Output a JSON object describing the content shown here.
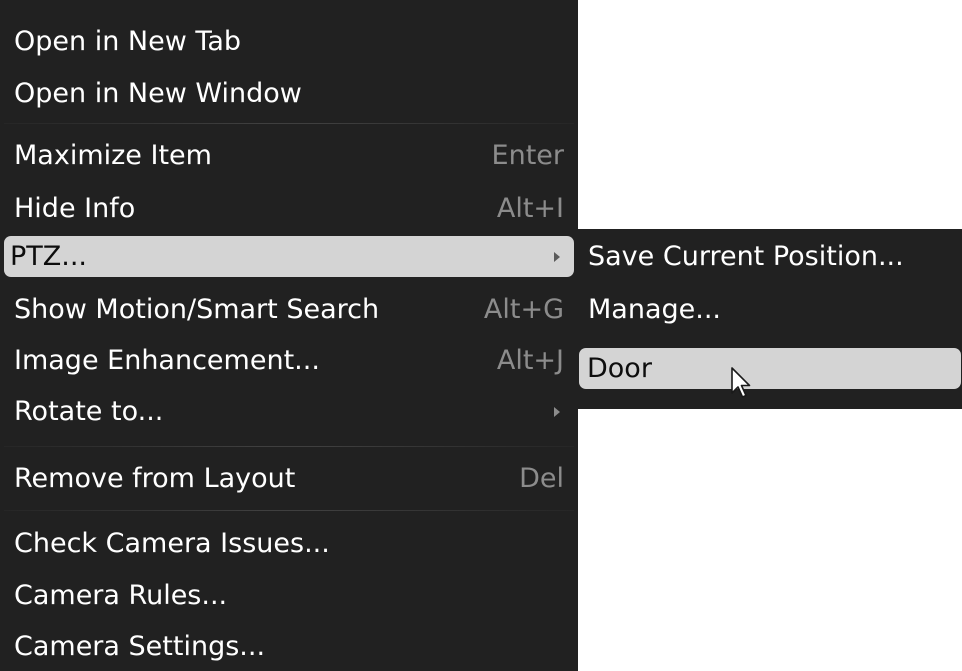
{
  "main_menu": {
    "items": [
      {
        "label": "Open in New Tab",
        "shortcut": ""
      },
      {
        "label": "Open in New Window",
        "shortcut": ""
      },
      {
        "label": "Maximize Item",
        "shortcut": "Enter"
      },
      {
        "label": "Hide Info",
        "shortcut": "Alt+I"
      },
      {
        "label": "PTZ...",
        "shortcut": "",
        "submenu": true,
        "highlighted": true
      },
      {
        "label": "Show Motion/Smart Search",
        "shortcut": "Alt+G"
      },
      {
        "label": "Image Enhancement...",
        "shortcut": "Alt+J"
      },
      {
        "label": "Rotate to...",
        "shortcut": "",
        "submenu": true
      },
      {
        "label": "Remove from Layout",
        "shortcut": "Del"
      },
      {
        "label": "Check Camera Issues...",
        "shortcut": ""
      },
      {
        "label": "Camera Rules...",
        "shortcut": ""
      },
      {
        "label": "Camera Settings...",
        "shortcut": ""
      }
    ]
  },
  "ptz_submenu": {
    "items": [
      {
        "label": "Save Current Position..."
      },
      {
        "label": "Manage..."
      },
      {
        "label": "Door",
        "highlighted": true
      }
    ]
  },
  "icons": {
    "submenu_arrow": "triangle-right-icon",
    "cursor": "mouse-pointer-icon"
  },
  "colors": {
    "menu_background": "#212121",
    "text": "#ffffff",
    "shortcut_text": "#8c8c8c",
    "highlight_background": "#d4d4d4",
    "highlight_text": "#0d0d0d"
  }
}
